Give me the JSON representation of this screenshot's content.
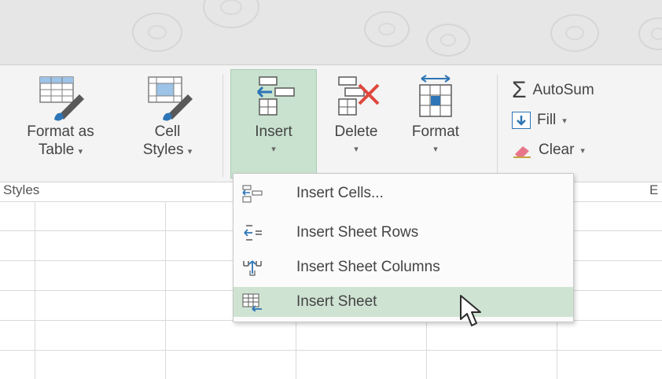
{
  "ribbon": {
    "format_as_table": {
      "line1": "Format as",
      "line2": "Table"
    },
    "cell_styles": {
      "line1": "Cell",
      "line2": "Styles"
    },
    "insert": {
      "label": "Insert"
    },
    "delete": {
      "label": "Delete"
    },
    "format": {
      "label": "Format"
    },
    "autosum": {
      "label": "AutoSum"
    },
    "fill": {
      "label": "Fill"
    },
    "clear": {
      "label": "Clear"
    },
    "group_styles": "Styles",
    "group_editing": "E",
    "caret": "▾"
  },
  "insert_menu": {
    "items": [
      {
        "label": "Insert Cells...",
        "icon": "insert-cells-icon"
      },
      {
        "label": "Insert Sheet Rows",
        "icon": "insert-rows-icon"
      },
      {
        "label": "Insert Sheet Columns",
        "icon": "insert-columns-icon"
      },
      {
        "label": "Insert Sheet",
        "icon": "insert-sheet-icon",
        "hovered": true
      }
    ]
  },
  "colors": {
    "active_green": "#c9e2cf",
    "hover_green": "#cfe3d3",
    "icon_blue": "#2e75b6",
    "delete_red": "#e0473c"
  }
}
